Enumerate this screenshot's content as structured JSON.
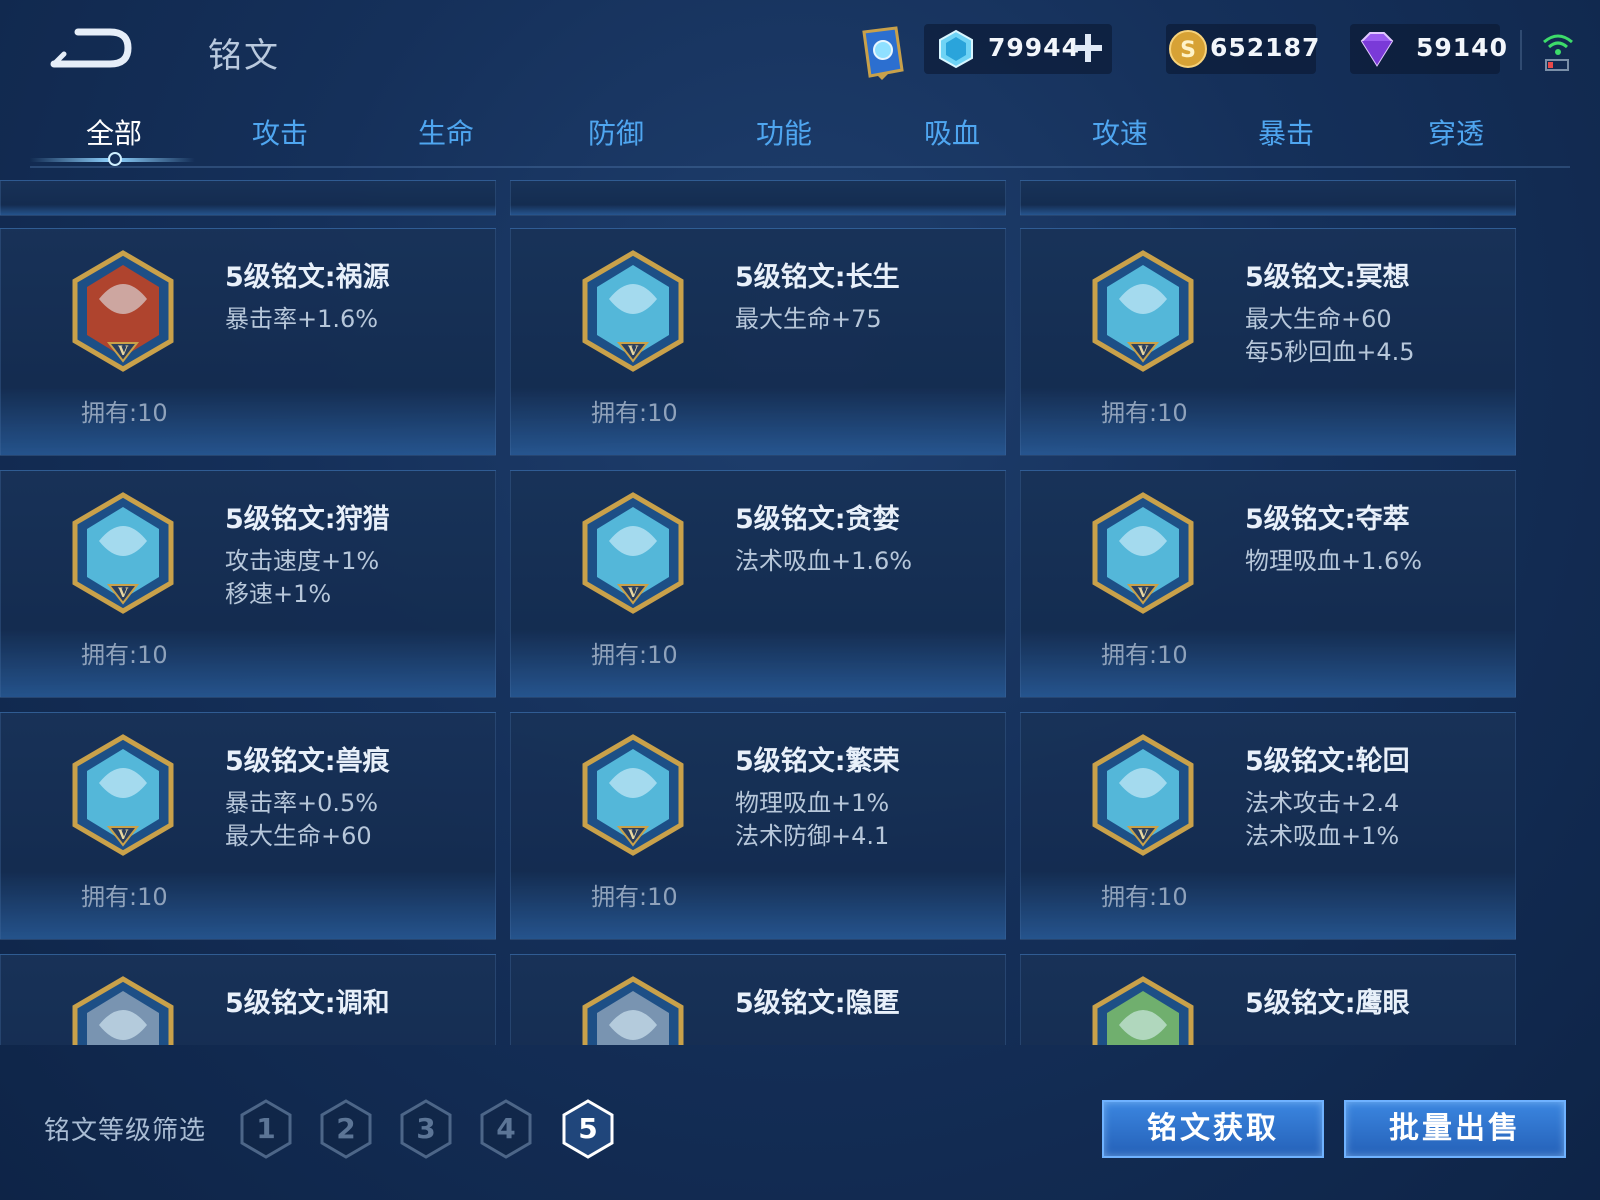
{
  "header": {
    "title": "铭文",
    "resources": [
      {
        "name": "diamond",
        "value": "79944"
      },
      {
        "name": "gold",
        "value": "652187"
      },
      {
        "name": "gem",
        "value": "59140"
      }
    ]
  },
  "tabs": [
    "全部",
    "攻击",
    "生命",
    "防御",
    "功能",
    "吸血",
    "攻速",
    "暴击",
    "穿透"
  ],
  "active_tab": "全部",
  "cards": [
    {
      "name": "5级铭文:祸源",
      "stats": [
        "暴击率+1.6%"
      ],
      "owned": "拥有:10",
      "color": "#c9421f"
    },
    {
      "name": "5级铭文:长生",
      "stats": [
        "最大生命+75"
      ],
      "owned": "拥有:10",
      "color": "#5ec9e8"
    },
    {
      "name": "5级铭文:冥想",
      "stats": [
        "最大生命+60",
        "每5秒回血+4.5"
      ],
      "owned": "拥有:10",
      "color": "#5ec9e8"
    },
    {
      "name": "5级铭文:狩猎",
      "stats": [
        "攻击速度+1%",
        "移速+1%"
      ],
      "owned": "拥有:10",
      "color": "#5ec9e8"
    },
    {
      "name": "5级铭文:贪婪",
      "stats": [
        "法术吸血+1.6%"
      ],
      "owned": "拥有:10",
      "color": "#5ec9e8"
    },
    {
      "name": "5级铭文:夺萃",
      "stats": [
        "物理吸血+1.6%"
      ],
      "owned": "拥有:10",
      "color": "#5ec9e8"
    },
    {
      "name": "5级铭文:兽痕",
      "stats": [
        "暴击率+0.5%",
        "最大生命+60"
      ],
      "owned": "拥有:10",
      "color": "#5ec9e8"
    },
    {
      "name": "5级铭文:繁荣",
      "stats": [
        "物理吸血+1%",
        "法术防御+4.1"
      ],
      "owned": "拥有:10",
      "color": "#5ec9e8"
    },
    {
      "name": "5级铭文:轮回",
      "stats": [
        "法术攻击+2.4",
        "法术吸血+1%"
      ],
      "owned": "拥有:10",
      "color": "#5ec9e8"
    },
    {
      "name": "5级铭文:调和",
      "stats": [],
      "owned": "",
      "color": "#8aa0b8"
    },
    {
      "name": "5级铭文:隐匿",
      "stats": [],
      "owned": "",
      "color": "#8aa0b8"
    },
    {
      "name": "5级铭文:鹰眼",
      "stats": [],
      "owned": "",
      "color": "#7fbf6a"
    }
  ],
  "footer": {
    "filter_label": "铭文等级筛选",
    "levels": [
      "1",
      "2",
      "3",
      "4",
      "5"
    ],
    "active_level": "5",
    "acquire_label": "铭文获取",
    "sell_label": "批量出售"
  },
  "colors": {
    "accent": "#4fa6f0",
    "button": "#2f74cc",
    "gold": "#c9a14a"
  }
}
